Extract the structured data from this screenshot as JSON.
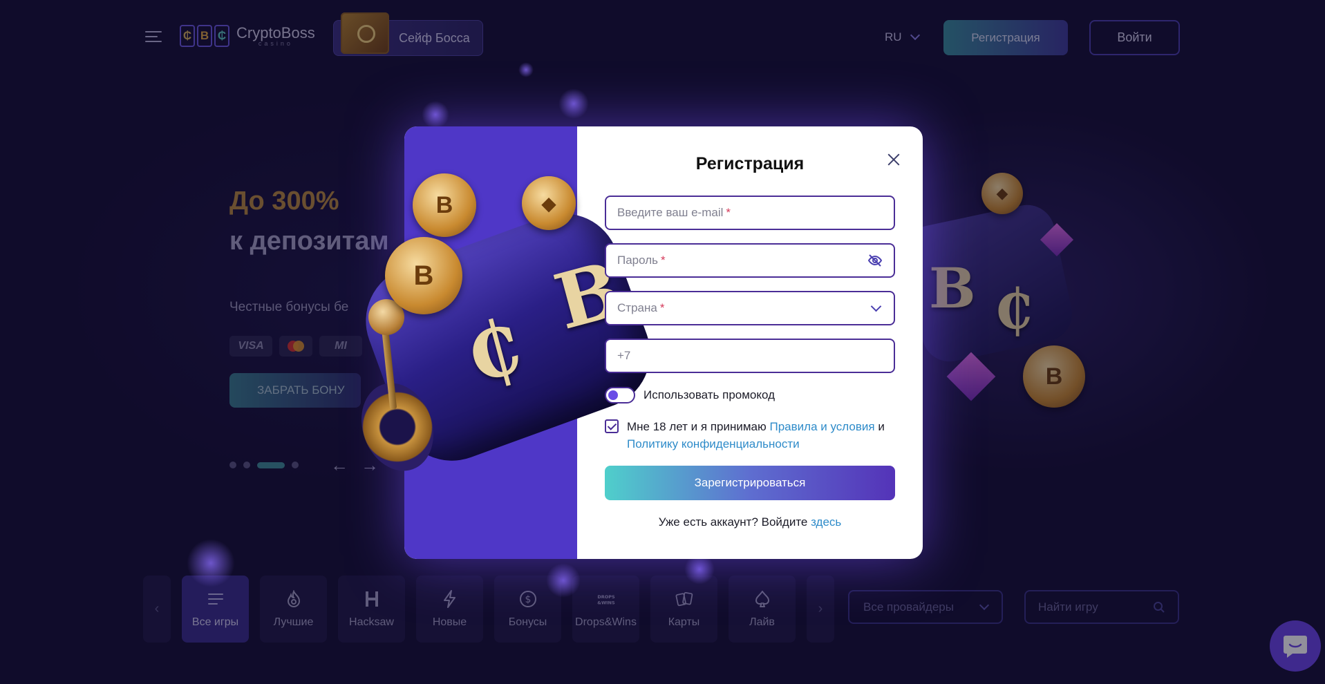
{
  "header": {
    "logo_text": "CryptoBoss",
    "logo_sub": "casino",
    "logo_letters": [
      "₵",
      "B",
      "₵"
    ],
    "safe_label": "Сейф Босса",
    "language": "RU",
    "register_label": "Регистрация",
    "login_label": "Войти"
  },
  "hero": {
    "title_line1": "До 300%",
    "title_line2": "к депозитам",
    "subtitle": "Честные бонусы бе",
    "payments": [
      "VISA",
      "",
      "MI"
    ],
    "cta_label": "ЗАБРАТЬ БОНУ",
    "arrow_prev": "←",
    "arrow_next": "→"
  },
  "categories": [
    {
      "label": "Все игры",
      "icon": "list-icon",
      "active": true
    },
    {
      "label": "Лучшие",
      "icon": "flame-icon"
    },
    {
      "label": "Hacksaw",
      "icon": "hacksaw-icon"
    },
    {
      "label": "Новые",
      "icon": "lightning-icon"
    },
    {
      "label": "Бонусы",
      "icon": "dollar-coin-icon"
    },
    {
      "label": "Drops&Wins",
      "icon": "drops-wins-icon"
    },
    {
      "label": "Карты",
      "icon": "cards-icon"
    },
    {
      "label": "Лайв",
      "icon": "spade-icon"
    }
  ],
  "filters": {
    "providers_label": "Все провайдеры",
    "search_placeholder": "Найти игру"
  },
  "modal": {
    "title": "Регистрация",
    "email_placeholder": "Введите ваш e-mail",
    "password_placeholder": "Пароль",
    "country_placeholder": "Страна",
    "required_mark": "*",
    "phone_value": "+7",
    "promo_label": "Использовать промокод",
    "agree_prefix": "Мне 18 лет и я принимаю",
    "rules_link": "Правила и условия",
    "agree_and": "и",
    "privacy_link": "Политику конфиденциальности",
    "submit_label": "Зарегистрироваться",
    "have_account": "Уже есть аккаунт? Войдите",
    "here_link": "здесь"
  },
  "colors": {
    "background": "#150f33",
    "accent_purple": "#4f37c7",
    "field_border": "#4a2d96",
    "link": "#2e8bc9",
    "gold": "#b8893c"
  }
}
